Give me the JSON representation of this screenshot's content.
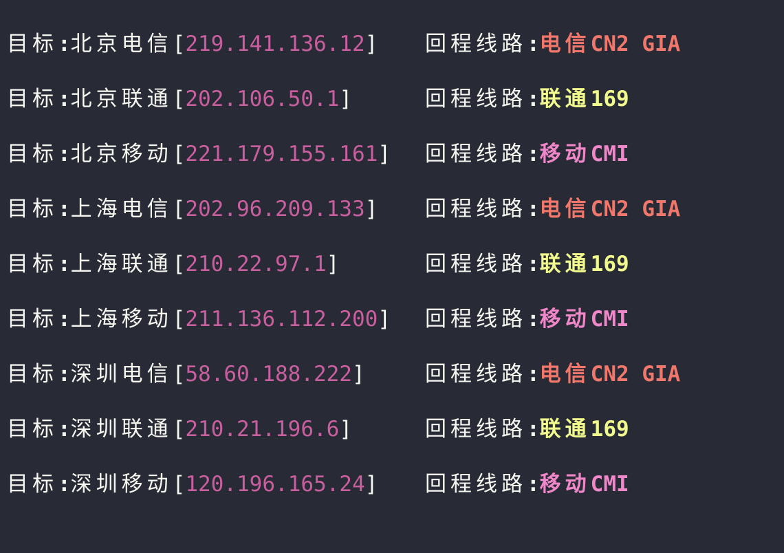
{
  "labels": {
    "target": "目标",
    "route": "回程线路",
    "colon": ":",
    "lb": "[",
    "rb": "]"
  },
  "colors": {
    "telecom": "#f1776a",
    "unicom": "#f1fa8c",
    "mobile": "#f087c8",
    "ip": "#c95f9e",
    "background": "#282a36"
  },
  "rows": [
    {
      "target": "北京电信",
      "ip": "219.141.136.12",
      "route_cn": "电信",
      "route_en": "CN2 GIA",
      "type": "telecom"
    },
    {
      "target": "北京联通",
      "ip": "202.106.50.1",
      "route_cn": "联通",
      "route_en": "169",
      "type": "unicom"
    },
    {
      "target": "北京移动",
      "ip": "221.179.155.161",
      "route_cn": "移动",
      "route_en": "CMI",
      "type": "mobile"
    },
    {
      "target": "上海电信",
      "ip": "202.96.209.133",
      "route_cn": "电信",
      "route_en": "CN2 GIA",
      "type": "telecom"
    },
    {
      "target": "上海联通",
      "ip": "210.22.97.1",
      "route_cn": "联通",
      "route_en": "169",
      "type": "unicom"
    },
    {
      "target": "上海移动",
      "ip": "211.136.112.200",
      "route_cn": "移动",
      "route_en": "CMI",
      "type": "mobile"
    },
    {
      "target": "深圳电信",
      "ip": "58.60.188.222",
      "route_cn": "电信",
      "route_en": "CN2 GIA",
      "type": "telecom"
    },
    {
      "target": "深圳联通",
      "ip": "210.21.196.6",
      "route_cn": "联通",
      "route_en": "169",
      "type": "unicom"
    },
    {
      "target": "深圳移动",
      "ip": "120.196.165.24",
      "route_cn": "移动",
      "route_en": "CMI",
      "type": "mobile"
    }
  ]
}
